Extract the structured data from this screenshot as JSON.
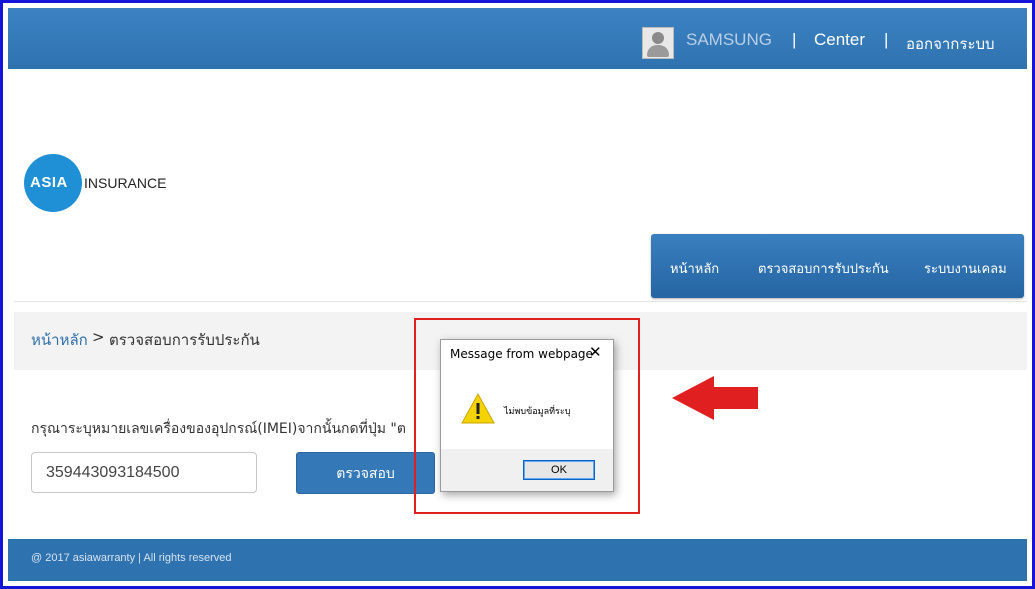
{
  "topbar": {
    "user_name": "SAMSUNG",
    "separator": "|",
    "center_label": "Center",
    "logout_label": "ออกจากระบบ"
  },
  "logo": {
    "circle_text": "ASIA",
    "side_text": "INSURANCE"
  },
  "nav": {
    "items": [
      {
        "label": "หน้าหลัก"
      },
      {
        "label": "ตรวจสอบการรับประกัน"
      },
      {
        "label": "ระบบงานเคลม"
      }
    ]
  },
  "breadcrumb": {
    "home": "หน้าหลัก",
    "separator": ">",
    "current": "ตรวจสอบการรับประกัน"
  },
  "form": {
    "instruction": "กรุณาระบุหมายเลขเครื่องของอุปกรณ์(IMEI)จากนั้นกดที่ปุ่ม \"ต",
    "imei_value": "359443093184500",
    "check_button": "ตรวจสอบ"
  },
  "footer": {
    "copyright": "@ 2017 asiawarranty | All rights reserved"
  },
  "dialog": {
    "title": "Message from webpage",
    "close_glyph": "✕",
    "message": "ไม่พบข้อมูลที่ระบุ",
    "ok_label": "OK",
    "icon": "warning-icon"
  },
  "colors": {
    "brand_blue": "#2f72b0",
    "frame_blue": "#1414d6",
    "annotation_red": "#e02020"
  }
}
